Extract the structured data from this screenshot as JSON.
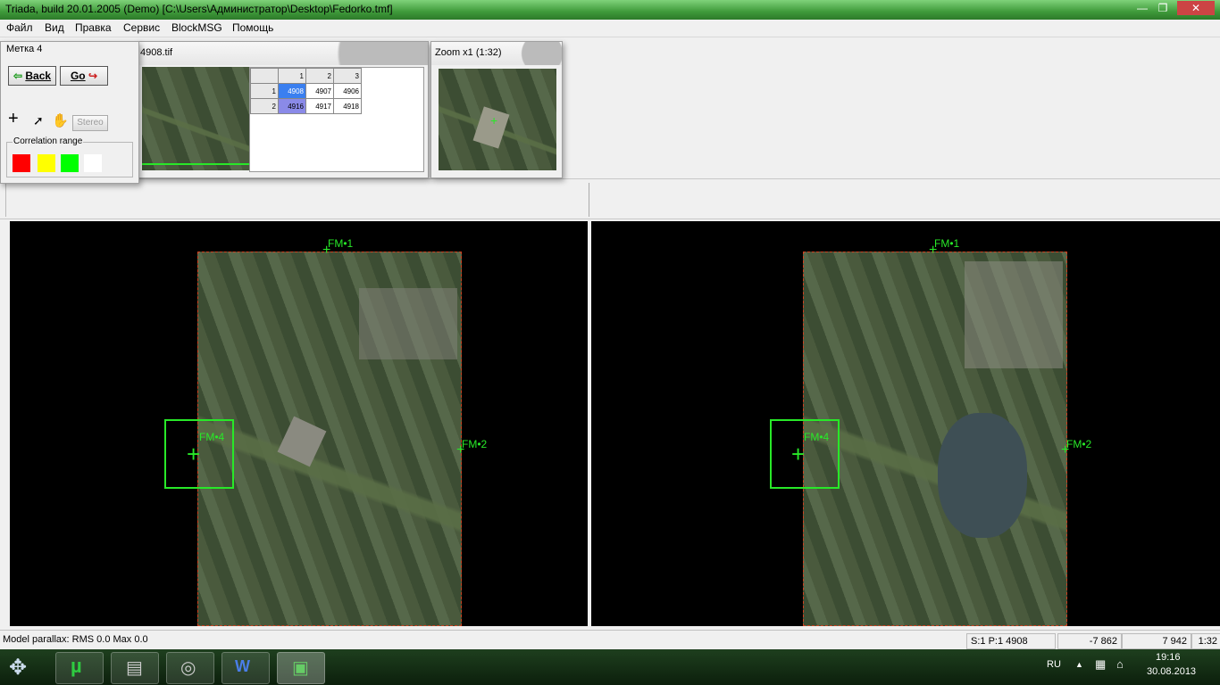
{
  "window": {
    "title": "Triada, build 20.01.2005 (Demo)  [C:\\Users\\Администратор\\Desktop\\Fedorko.tmf]",
    "controls": [
      "—",
      "❐",
      "✕"
    ]
  },
  "menu": [
    "Файл",
    "Вид",
    "Правка",
    "Сервис",
    "BlockMSG",
    "Помощь"
  ],
  "mark_panel": {
    "title": "Метка 4",
    "back_label": "Back",
    "go_label": "Go",
    "stereo_label": "Stereo",
    "correlation_label": "Correlation range",
    "swatches": [
      "#ff0000",
      "#ffff00",
      "#00ff00",
      "#ffffff"
    ]
  },
  "overview_panel": {
    "title": "4908.tif",
    "grid": {
      "col_headers": [
        "1",
        "2",
        "3"
      ],
      "rows": [
        {
          "header": "1",
          "cells": [
            "4908",
            "4907",
            "4906"
          ]
        },
        {
          "header": "2",
          "cells": [
            "4916",
            "4917",
            "4918"
          ]
        }
      ]
    }
  },
  "zoom_panel": {
    "title": "Zoom x1 (1:32)"
  },
  "views": {
    "left": {
      "marks": [
        "FM•1",
        "FM•2",
        "FM•4"
      ]
    },
    "right": {
      "marks": [
        "FM•1",
        "FM•2",
        "FM•4"
      ]
    }
  },
  "status": {
    "message": "Model parallax: RMS 0.0 Max 0.0",
    "sp": "S:1  P:1  4908",
    "x": "-7 862",
    "y": "7 942",
    "scale": "1:32"
  },
  "taskbar": {
    "lang": "RU",
    "time": "19:16",
    "date": "30.08.2013"
  },
  "colors": {
    "fiducial_green": "#28e828",
    "active_cell": "#3a7ff0",
    "selected_cell": "#8a8ae8"
  }
}
